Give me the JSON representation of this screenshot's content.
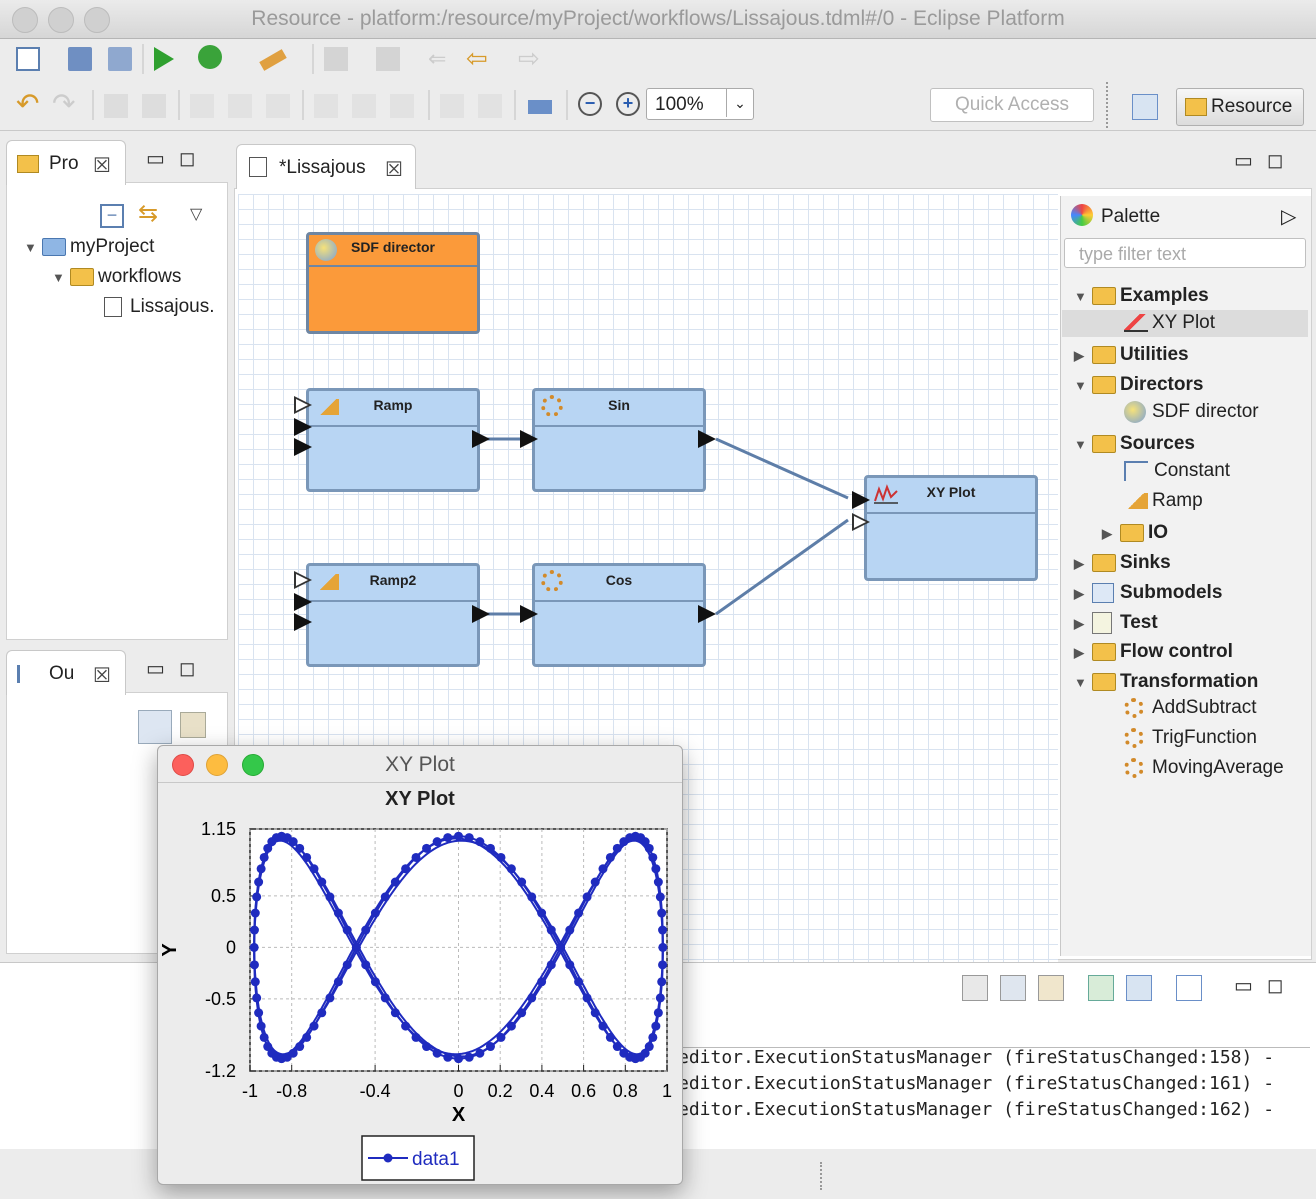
{
  "window": {
    "title": "Resource - platform:/resource/myProject/workflows/Lissajous.tdml#/0 - Eclipse Platform"
  },
  "toolbar": {
    "zoom": "100%",
    "quick_access_placeholder": "Quick Access",
    "perspective": "Resource"
  },
  "project_explorer": {
    "tab_label": "Pro",
    "tree": [
      {
        "label": "myProject",
        "level": 0,
        "expanded": true
      },
      {
        "label": "workflows",
        "level": 1,
        "expanded": true
      },
      {
        "label": "Lissajous.",
        "level": 2
      }
    ]
  },
  "outline": {
    "tab_label": "Ou"
  },
  "editor": {
    "tab_label": "*Lissajous",
    "actors": [
      {
        "id": "director",
        "name": "SDF director"
      },
      {
        "id": "ramp",
        "name": "Ramp"
      },
      {
        "id": "sin",
        "name": "Sin"
      },
      {
        "id": "ramp2",
        "name": "Ramp2"
      },
      {
        "id": "cos",
        "name": "Cos"
      },
      {
        "id": "xyplot",
        "name": "XY Plot"
      }
    ]
  },
  "palette": {
    "title": "Palette",
    "filter_placeholder": "type filter text",
    "rows": [
      {
        "label": "Examples",
        "category": true,
        "expanded": true
      },
      {
        "label": "XY Plot",
        "category": false,
        "selected": true
      },
      {
        "label": "Utilities",
        "category": true,
        "expanded": false
      },
      {
        "label": "Directors",
        "category": true,
        "expanded": true
      },
      {
        "label": "SDF director",
        "category": false
      },
      {
        "label": "Sources",
        "category": true,
        "expanded": true
      },
      {
        "label": "Constant",
        "category": false
      },
      {
        "label": "Ramp",
        "category": false
      },
      {
        "label": "IO",
        "category": true,
        "expanded": false,
        "nested": true
      },
      {
        "label": "Sinks",
        "category": true,
        "expanded": false
      },
      {
        "label": "Submodels",
        "category": true,
        "expanded": false
      },
      {
        "label": "Test",
        "category": true,
        "expanded": false
      },
      {
        "label": "Flow control",
        "category": true,
        "expanded": false
      },
      {
        "label": "Transformation",
        "category": true,
        "expanded": true
      },
      {
        "label": "AddSubtract",
        "category": false
      },
      {
        "label": "TrigFunction",
        "category": false
      },
      {
        "label": "MovingAverage",
        "category": false
      }
    ]
  },
  "console": {
    "lines": [
      "editor.ExecutionStatusManager (fireStatusChanged:158) -",
      "editor.ExecutionStatusManager (fireStatusChanged:161) -",
      "editor.ExecutionStatusManager (fireStatusChanged:162) -"
    ]
  },
  "plot_window": {
    "title": "XY Plot"
  },
  "chart_data": {
    "type": "line",
    "title": "XY Plot",
    "xlabel": "X",
    "ylabel": "Y",
    "xlim": [
      -1,
      1
    ],
    "ylim": [
      -1.2,
      1.15
    ],
    "xticks": [
      "-1",
      "-0.8",
      "-0.4",
      "0",
      "0.2",
      "0.4",
      "0.6",
      "0.8",
      "1"
    ],
    "yticks": [
      "1.15",
      "0.5",
      "0",
      "-0.5",
      "-1.2"
    ],
    "grid": true,
    "legend_position": "bottom",
    "series": [
      {
        "name": "data1",
        "color": "#1f2bbf",
        "curve": "x = sin(t), y = cos(3t)"
      }
    ]
  }
}
